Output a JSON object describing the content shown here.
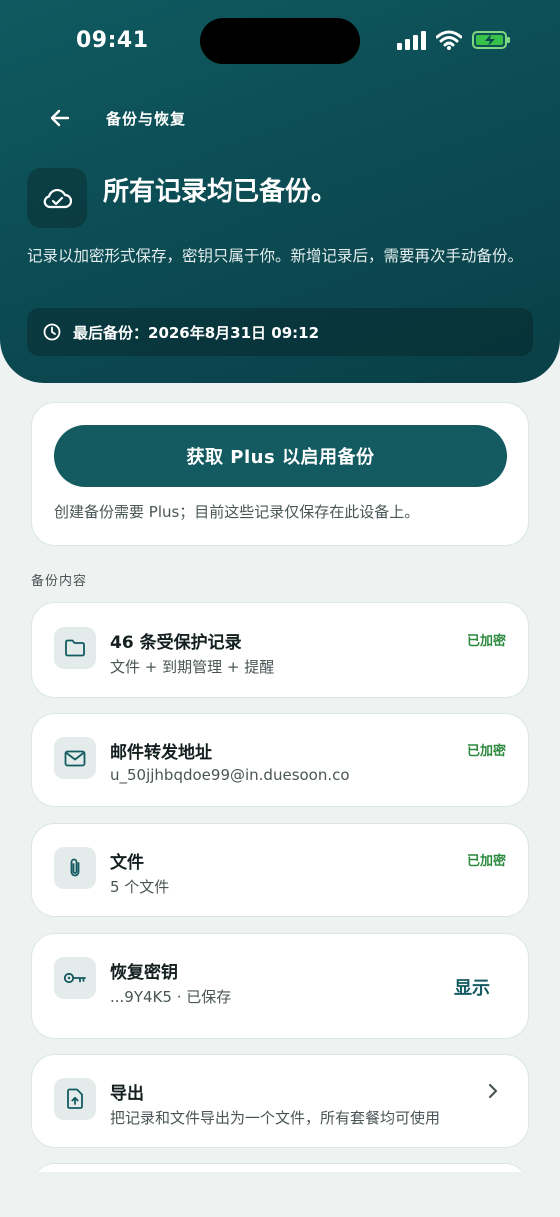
{
  "status_bar": {
    "time": "09:41"
  },
  "nav": {
    "title": "备份与恢复"
  },
  "hero": {
    "title": "所有记录均已备份。",
    "description": "记录以加密形式保存，密钥只属于你。新增记录后，需要再次手动备份。",
    "last_backup": "最后备份：2026年8月31日 09:12"
  },
  "plus": {
    "button_label": "获取 Plus 以启用备份",
    "note": "创建备份需要 Plus；目前这些记录仅保存在此设备上。"
  },
  "section_label": "备份内容",
  "items": [
    {
      "icon": "folder-icon",
      "title": "46 条受保护记录",
      "subtitle": "文件 + 到期管理 + 提醒",
      "badge": "已加密"
    },
    {
      "icon": "mail-icon",
      "title": "邮件转发地址",
      "subtitle": "u_50jjhbqdoe99@in.duesoon.co",
      "badge": "已加密"
    },
    {
      "icon": "paperclip-icon",
      "title": "文件",
      "subtitle": "5 个文件",
      "badge": "已加密"
    },
    {
      "icon": "key-icon",
      "title": "恢复密钥",
      "subtitle": "...9Y4K5 · 已保存",
      "action": "显示"
    },
    {
      "icon": "export-icon",
      "title": "导出",
      "subtitle": "把记录和文件导出为一个文件，所有套餐均可使用"
    }
  ],
  "colors": {
    "accent": "#135a61",
    "header": "#0f5a60",
    "encrypted": "#2c8a3f",
    "background": "#eef3f2"
  }
}
